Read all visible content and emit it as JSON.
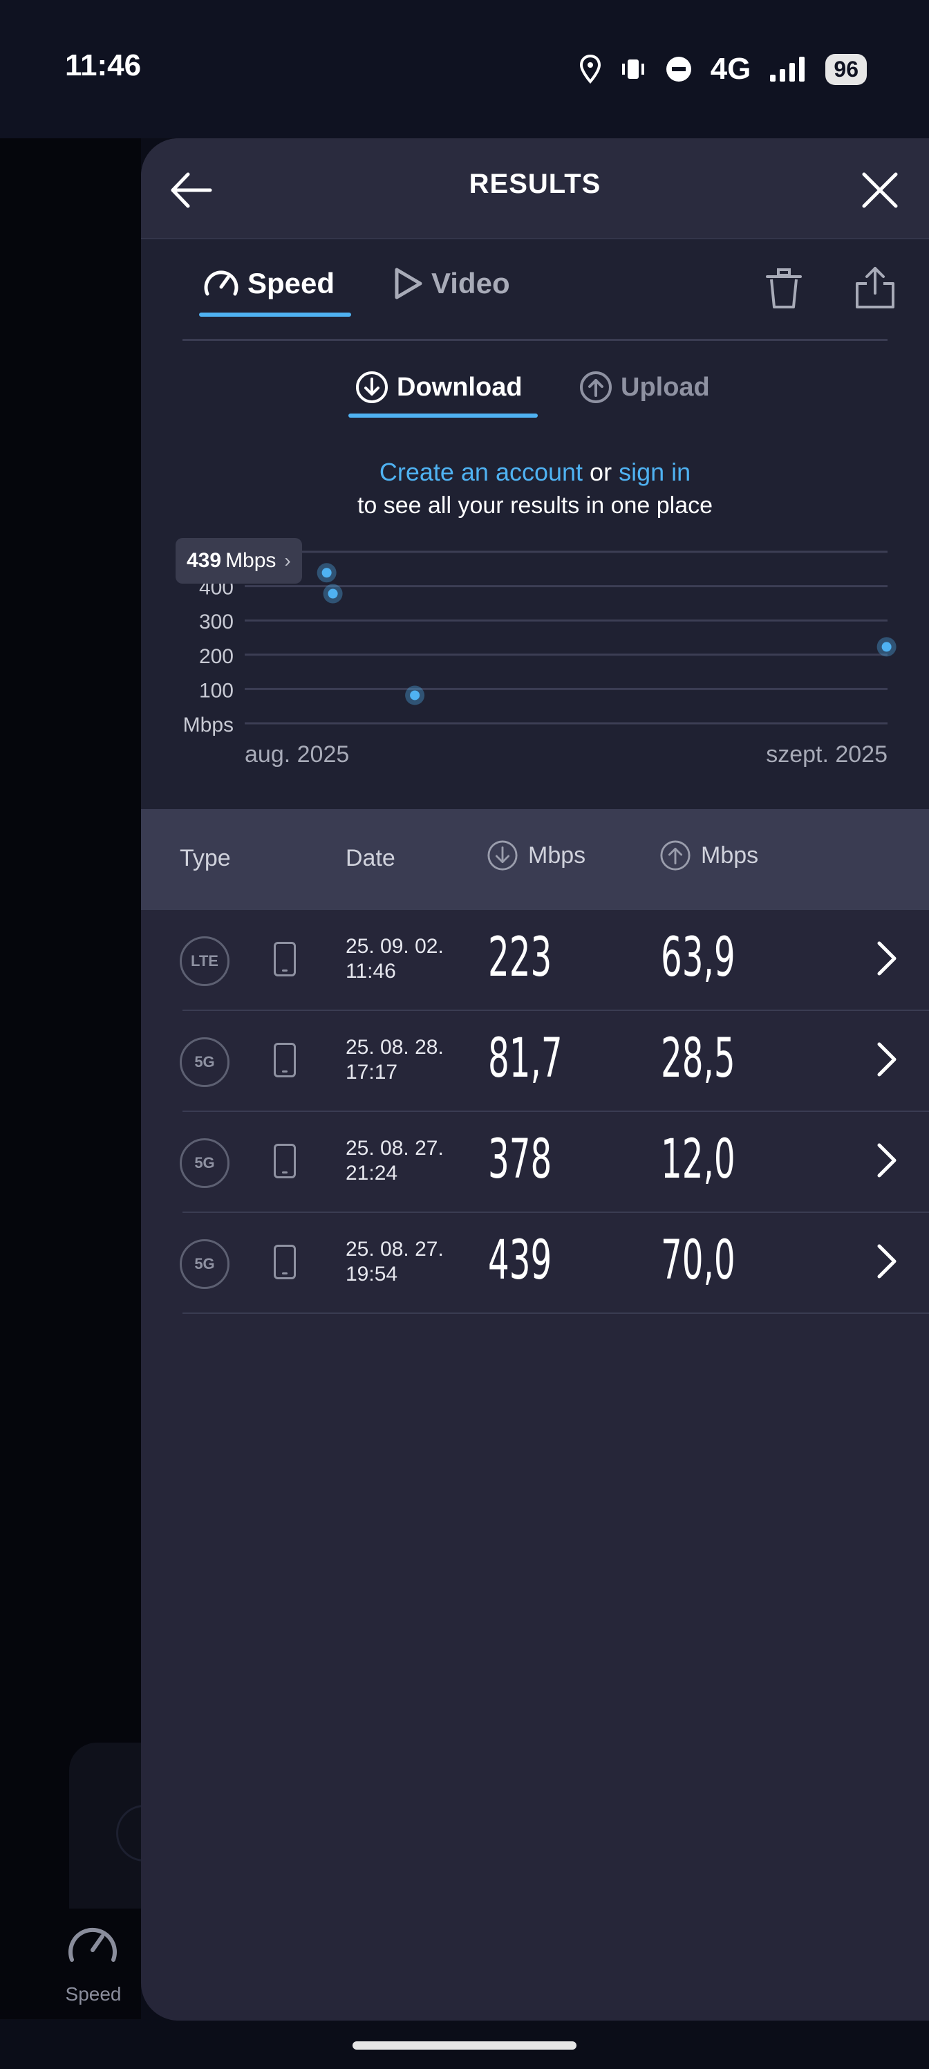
{
  "status": {
    "time": "11:46",
    "network": "4G",
    "battery": "96"
  },
  "nav": {
    "speed_label": "Speed"
  },
  "header": {
    "title": "RESULTS"
  },
  "tabs": {
    "speed": "Speed",
    "video": "Video"
  },
  "subtabs": {
    "download": "Download",
    "upload": "Upload"
  },
  "promo": {
    "create": "Create an account",
    "or": "or",
    "sign_in": "sign in",
    "line2": "to see all your results in one place"
  },
  "tooltip": {
    "value": "439",
    "unit": "Mbps"
  },
  "chart_data": {
    "type": "scatter",
    "y_ticks": [
      "400",
      "300",
      "200",
      "100"
    ],
    "ylabel": "Mbps",
    "x_labels": [
      "aug. 2025",
      "szept. 2025"
    ],
    "ylim": [
      0,
      500
    ],
    "x_range": [
      "2025-08-27",
      "2025-09-02"
    ],
    "points": [
      {
        "x": "2025-08-27 19:54",
        "y": 439
      },
      {
        "x": "2025-08-27 21:24",
        "y": 378
      },
      {
        "x": "2025-08-28 17:17",
        "y": 81.7
      },
      {
        "x": "2025-09-02 11:46",
        "y": 223
      }
    ],
    "grid": true,
    "accent": "#4fb2f2"
  },
  "table": {
    "headers": {
      "type": "Type",
      "date": "Date",
      "down": "Mbps",
      "up": "Mbps"
    },
    "rows": [
      {
        "type": "LTE",
        "date1": "25. 09. 02.",
        "date2": "11:46",
        "down": "223",
        "up": "63,9"
      },
      {
        "type": "5G",
        "date1": "25. 08. 28.",
        "date2": "17:17",
        "down": "81,7",
        "up": "28,5"
      },
      {
        "type": "5G",
        "date1": "25. 08. 27.",
        "date2": "21:24",
        "down": "378",
        "up": "12,0"
      },
      {
        "type": "5G",
        "date1": "25. 08. 27.",
        "date2": "19:54",
        "down": "439",
        "up": "70,0"
      }
    ]
  },
  "colors": {
    "accent": "#4fb2f2",
    "sheet": "#262639",
    "header_row": "#3a3c52"
  }
}
